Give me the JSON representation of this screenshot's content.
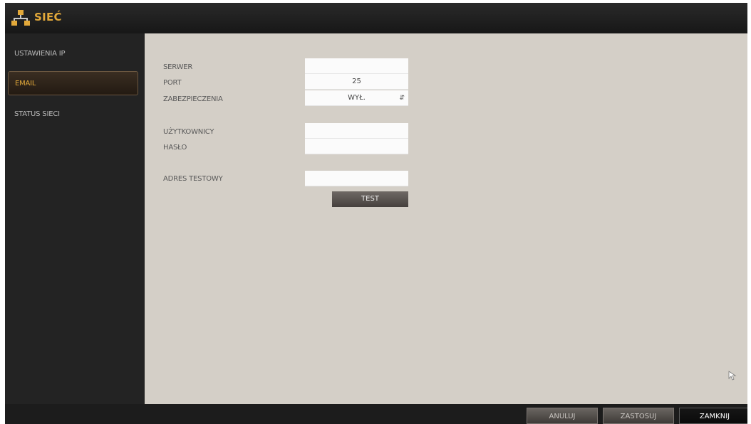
{
  "window": {
    "title": "SIEĆ",
    "icon": "network-icon"
  },
  "sidebar": {
    "items": [
      {
        "label": "USTAWIENIA IP",
        "active": false
      },
      {
        "label": "EMAIL",
        "active": true
      },
      {
        "label": "STATUS SIECI",
        "active": false
      }
    ]
  },
  "form": {
    "server": {
      "label": "SERWER",
      "value": ""
    },
    "port": {
      "label": "PORT",
      "value": "25"
    },
    "security": {
      "label": "ZABEZPIECZENIA",
      "value": "WYŁ."
    },
    "user": {
      "label": "UŻYTKOWNICY",
      "value": ""
    },
    "password": {
      "label": "HASŁO",
      "value": ""
    },
    "test_address": {
      "label": "ADRES TESTOWY",
      "value": ""
    },
    "test_button": "TEST"
  },
  "footer": {
    "cancel": "ANULUJ",
    "apply": "ZASTOSUJ",
    "close": "ZAMKNIJ"
  },
  "colors": {
    "accent": "#e3a93a",
    "panel": "#d4cfc7",
    "background": "#1c1c1c"
  }
}
